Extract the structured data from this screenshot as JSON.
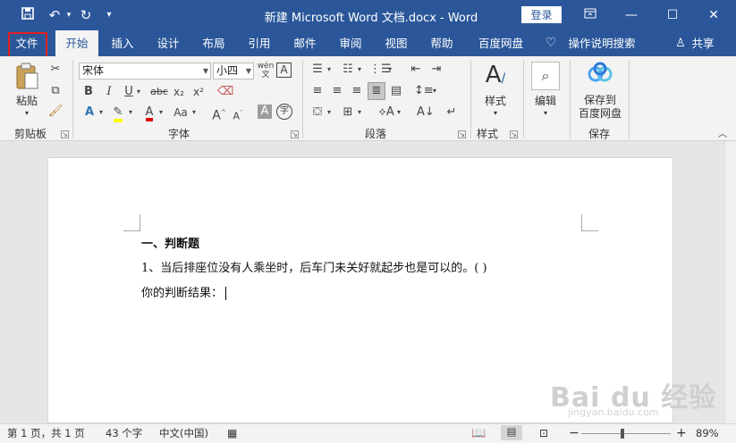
{
  "titlebar": {
    "save_icon": "save-icon",
    "undo_icon": "undo-icon",
    "redo_icon": "redo-icon",
    "customize_icon": "qat-customize-icon",
    "document_title": "新建 Microsoft Word 文档.docx  -  Word",
    "login_label": "登录",
    "ribbon_display_icon": "ribbon-display-options-icon",
    "minimize": "—",
    "maximize": "☐",
    "close": "✕"
  },
  "tabs": [
    "文件",
    "开始",
    "插入",
    "设计",
    "布局",
    "引用",
    "邮件",
    "审阅",
    "视图",
    "帮助",
    "百度网盘"
  ],
  "tell_me": "操作说明搜索",
  "share": "共享",
  "ribbon": {
    "clipboard": {
      "paste": "粘贴",
      "label": "剪贴板"
    },
    "font": {
      "font_name": "宋体",
      "font_size": "小四",
      "label": "字体",
      "bold": "B",
      "italic": "I",
      "underline": "U",
      "strike": "abc",
      "subscript": "x₂",
      "superscript": "x²",
      "case": "Aa",
      "grow": "A",
      "shrink": "A",
      "wen": "wén"
    },
    "paragraph": {
      "label": "段落"
    },
    "styles": {
      "styles_btn": "样式",
      "label": "样式"
    },
    "editing": {
      "edit_btn": "编辑"
    },
    "save": {
      "save_btn_line1": "保存到",
      "save_btn_line2": "百度网盘",
      "label": "保存"
    }
  },
  "document": {
    "line1": "一、判断题",
    "line2": "1、当后排座位没有人乘坐时，后车门未关好就起步也是可以的。( )",
    "line3": "你的判断结果："
  },
  "statusbar": {
    "page": "第 1 页，共 1 页",
    "words": "43 个字",
    "language": "中文(中国)",
    "zoom": "89%",
    "minus": "−",
    "plus": "+"
  },
  "watermark": {
    "main": "Bai du 经验",
    "sub": "jingyan.baidu.com"
  },
  "colors": {
    "accent": "#2b579a",
    "highlight_box": "#e02020"
  }
}
